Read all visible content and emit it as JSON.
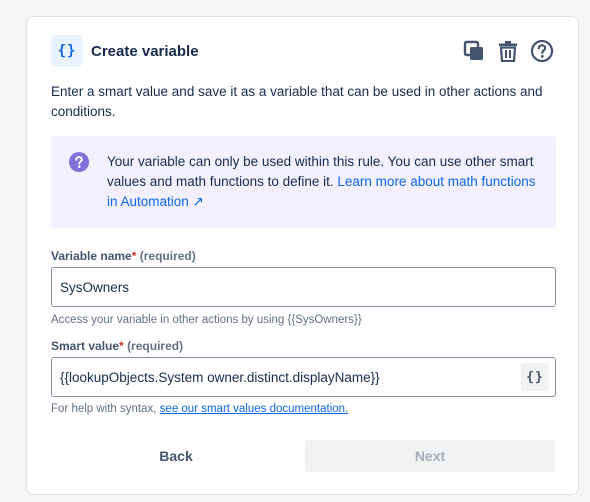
{
  "dialog": {
    "title": "Create variable",
    "header_icon": "{}",
    "actions": [
      "copy-icon",
      "trash-icon",
      "help-icon"
    ],
    "description": "Enter a smart value and save it as a variable that can be used in other actions and conditions.",
    "info": {
      "text": "Your variable can only be used within this rule. You can use other smart values and math functions to define it.",
      "link": "Learn more about math functions in Automation ↗"
    },
    "variable_name": {
      "label": "Variable name",
      "required_star": "*",
      "required_text": "(required)",
      "value": "SysOwners",
      "helper": "Access your variable in other actions by using {{SysOwners}}"
    },
    "smart_value": {
      "label": "Smart value",
      "required_star": "*",
      "required_text": "(required)",
      "value": "{{lookupObjects.System owner.distinct.displayName}}",
      "button": "{}",
      "helper_prefix": "For help with syntax,",
      "helper_link": "see our smart values documentation."
    },
    "buttons": {
      "back": "Back",
      "next": "Next"
    }
  },
  "colors": {
    "accent": "#0c66e4",
    "info_bg": "#f3f0ff",
    "info_icon": "#8270db",
    "required": "#c9372c"
  }
}
